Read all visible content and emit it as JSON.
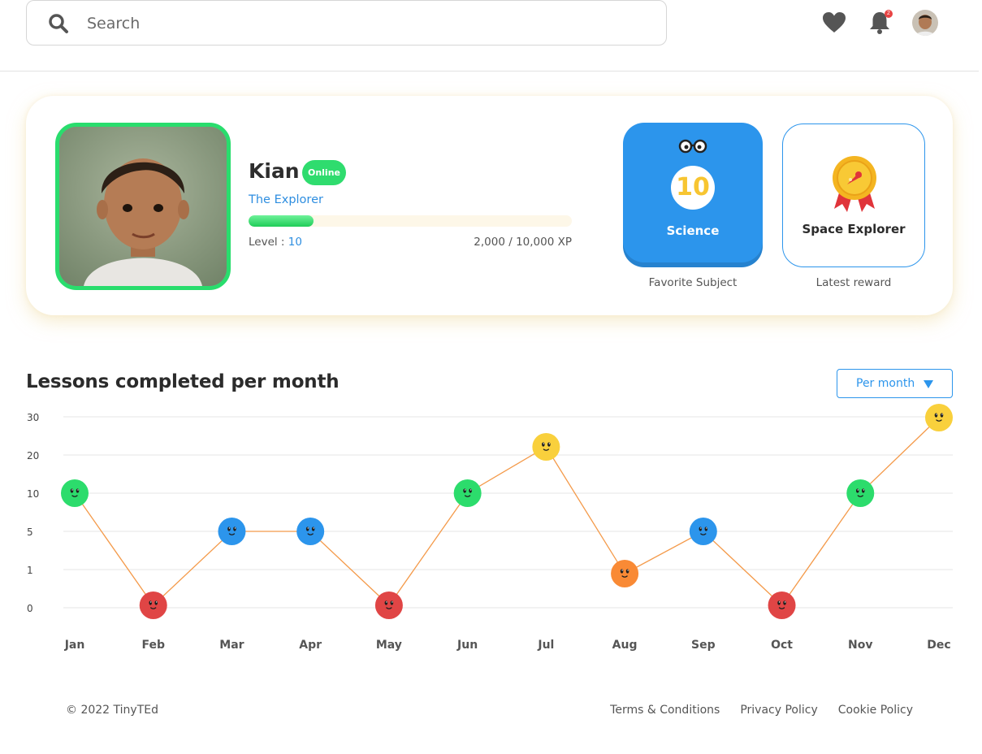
{
  "search": {
    "placeholder": "Search"
  },
  "header": {
    "notification_count": "2",
    "icons": [
      "heart-icon",
      "bell-icon",
      "avatar"
    ]
  },
  "profile": {
    "name": "Kian",
    "status": "Online",
    "title": "The Explorer",
    "level_label": "Level : ",
    "level": "10",
    "xp_text": "2,000 / 10,000 XP",
    "xp_progress": 0.2
  },
  "favorite_subject": {
    "count": "10",
    "name": "Science",
    "caption": "Favorite Subject"
  },
  "latest_reward": {
    "name": "Space Explorer",
    "caption": "Latest reward"
  },
  "colors": {
    "green": "#2cdc6c",
    "red": "#e04545",
    "blue": "#2c95ec",
    "yellow": "#f9d03c",
    "orange": "#f98a35",
    "line": "#f49a4a"
  },
  "chart_data": {
    "type": "line",
    "title": "Lessons completed per month",
    "period_select": "Per month",
    "x": [
      "Jan",
      "Feb",
      "Mar",
      "Apr",
      "May",
      "Jun",
      "Jul",
      "Aug",
      "Sep",
      "Oct",
      "Nov",
      "Dec"
    ],
    "y": [
      10,
      0,
      5,
      5,
      0,
      10,
      20,
      1,
      5,
      0,
      10,
      30
    ],
    "y_ticks": [
      "30",
      "20",
      "10",
      "5",
      "1",
      "0"
    ],
    "point_colors": [
      "green",
      "red",
      "blue",
      "blue",
      "red",
      "green",
      "yellow",
      "orange",
      "blue",
      "red",
      "green",
      "yellow"
    ],
    "grid": true
  },
  "footer": {
    "copyright": "© 2022 TinyTEd",
    "links": [
      "Terms & Conditions",
      "Privacy Policy",
      "Cookie Policy"
    ]
  }
}
